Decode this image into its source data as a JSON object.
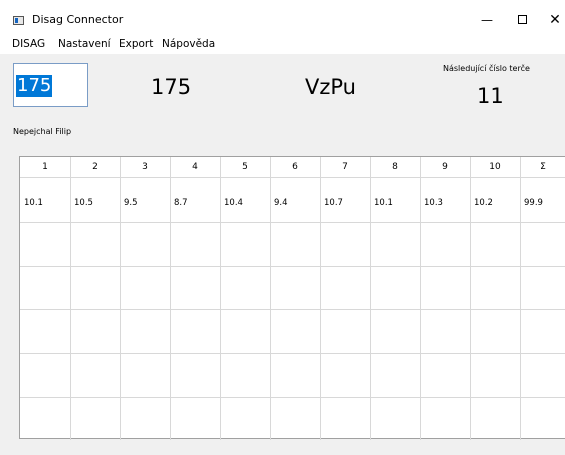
{
  "window": {
    "title": "Disag Connector",
    "minimize_glyph": "—",
    "close_glyph": "✕"
  },
  "menu": [
    "DISAG",
    "Nastavení",
    "Export",
    "Nápověda"
  ],
  "shot_input": {
    "selected_value": "175"
  },
  "display": {
    "number": "175",
    "code": "VzPu",
    "next_target_label": "Následující číslo terče",
    "next_target_value": "11"
  },
  "player_name": "Nepejchal Filip",
  "table": {
    "headers": [
      "1",
      "2",
      "3",
      "4",
      "5",
      "6",
      "7",
      "8",
      "9",
      "10",
      "Σ"
    ],
    "rows": [
      [
        "10.1",
        "10.5",
        "9.5",
        "8.7",
        "10.4",
        "9.4",
        "10.7",
        "10.1",
        "10.3",
        "10.2",
        "99.9"
      ]
    ]
  },
  "colors": {
    "selection": "#0078d7",
    "background": "#f0f0f0"
  }
}
